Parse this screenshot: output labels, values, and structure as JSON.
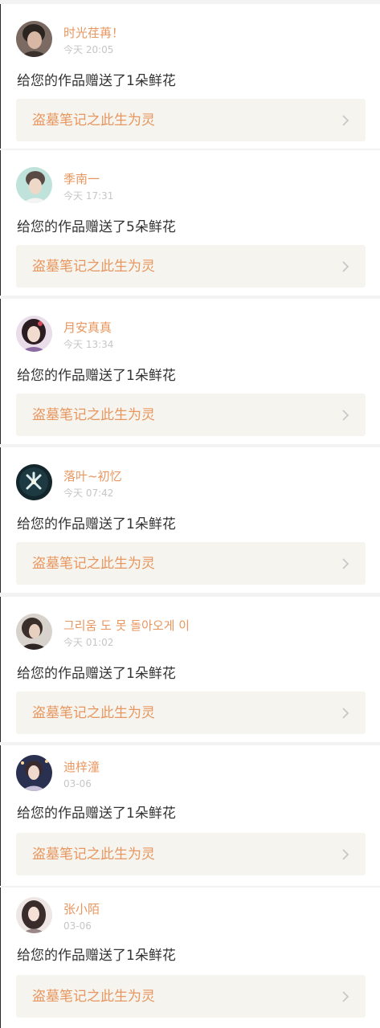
{
  "notifications": [
    {
      "username": "时光荏苒！",
      "time": "今天 20:05",
      "message": "给您的作品赠送了1朵鲜花",
      "work_title": "盗墓笔记之此生为灵",
      "avatar": "avatar-photo-young-man"
    },
    {
      "username": "季南一",
      "time": "今天 17:31",
      "message": "给您的作品赠送了5朵鲜花",
      "work_title": "盗墓笔记之此生为灵",
      "avatar": "avatar-photo-teal-portrait"
    },
    {
      "username": "月安真真",
      "time": "今天 13:34",
      "message": "给您的作品赠送了1朵鲜花",
      "work_title": "盗墓笔记之此生为灵",
      "avatar": "avatar-illustration-costume-girl"
    },
    {
      "username": "落叶~初忆",
      "time": "今天 07:42",
      "message": "给您的作品赠送了1朵鲜花",
      "work_title": "盗墓笔记之此生为灵",
      "avatar": "avatar-flower-night"
    },
    {
      "username": "그리움 도 못 돌아오게 이",
      "time": "今天 01:02",
      "message": "给您的作品赠送了1朵鲜花",
      "work_title": "盗墓笔记之此生为灵",
      "avatar": "avatar-photo-dark-hair"
    },
    {
      "username": "迪梓潼",
      "time": "03-06",
      "message": "给您的作品赠送了1朵鲜花",
      "work_title": "盗墓笔记之此生为灵",
      "avatar": "avatar-photo-girl-night"
    },
    {
      "username": "张小陌",
      "time": "03-06",
      "message": "给您的作品赠送了1朵鲜花",
      "work_title": "盗墓笔记之此生为灵",
      "avatar": "avatar-photo-long-hair"
    }
  ],
  "colors": {
    "accent": "#e8965f",
    "muted": "#c6c6c6",
    "text": "#333333",
    "link_background": "#f5f4ee",
    "separator": "#f3f3f3"
  },
  "icons": {
    "chevron": "chevron-right-icon"
  }
}
